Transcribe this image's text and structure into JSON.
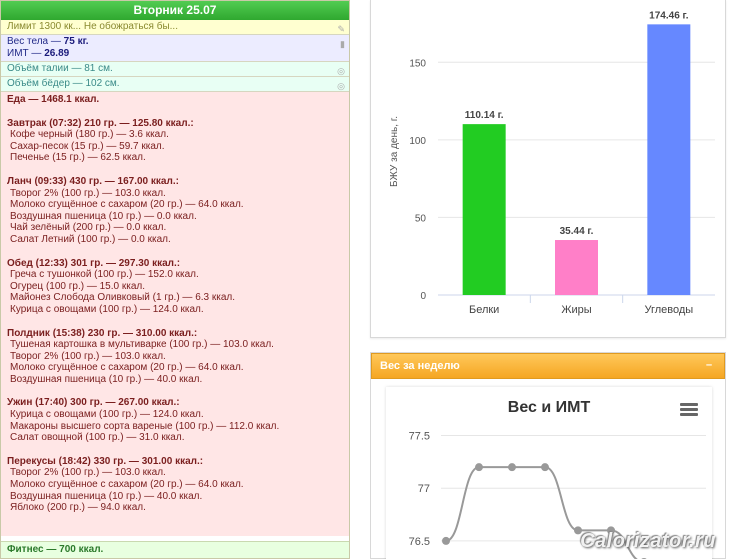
{
  "diary": {
    "date_title": "Вторник 25.07",
    "limit_text": "Лимит 1300 кк... Не обожраться бы...",
    "weight_label": "Вес тела — ",
    "weight_value": "75 кг.",
    "bmi_label": "ИМТ — ",
    "bmi_value": "26.89",
    "waist": "Объём талии — 81 см.",
    "hips": "Объём бёдер — 102 см.",
    "food_total": "Еда — 1468.1 ккал.",
    "meals": [
      {
        "title": "Завтрак (07:32) 210 гр. — 125.80 ккал.:",
        "items": [
          "Кофе черный (180 гр.) — 3.6 ккал.",
          "Сахар-песок (15 гр.) — 59.7 ккал.",
          "Печенье (15 гр.) — 62.5 ккал."
        ]
      },
      {
        "title": "Ланч (09:33) 430 гр. — 167.00 ккал.:",
        "items": [
          "Творог 2% (100 гр.) — 103.0 ккал.",
          "Молоко сгущённое с сахаром (20 гр.) — 64.0 ккал.",
          "Воздушная пшеница (10 гр.) — 0.0 ккал.",
          "Чай зелёный (200 гр.) — 0.0 ккал.",
          "Салат Летний (100 гр.) — 0.0 ккал."
        ]
      },
      {
        "title": "Обед (12:33) 301 гр. — 297.30 ккал.:",
        "items": [
          "Греча с тушонкой (100 гр.) — 152.0 ккал.",
          "Огурец (100 гр.) — 15.0 ккал.",
          "Майонез Слобода Оливковый (1 гр.) — 6.3 ккал.",
          "Курица с овощами (100 гр.) — 124.0 ккал."
        ]
      },
      {
        "title": "Полдник (15:38) 230 гр. — 310.00 ккал.:",
        "items": [
          "Тушеная картошка в мультиварке (100 гр.) — 103.0 ккал.",
          "Творог 2% (100 гр.) — 103.0 ккал.",
          "Молоко сгущённое с сахаром (20 гр.) — 64.0 ккал.",
          "Воздушная пшеница (10 гр.) — 40.0 ккал."
        ]
      },
      {
        "title": "Ужин (17:40) 300 гр. — 267.00 ккал.:",
        "items": [
          "Курица с овощами (100 гр.) — 124.0 ккал.",
          "Макароны высшего сорта вареные (100 гр.) — 112.0 ккал.",
          "Салат овощной (100 гр.) — 31.0 ккал."
        ]
      },
      {
        "title": "Перекусы (18:42) 330 гр. — 301.00 ккал.:",
        "items": [
          "Творог 2% (100 гр.) — 103.0 ккал.",
          "Молоко сгущённое с сахаром (20 гр.) — 64.0 ккал.",
          "Воздушная пшеница (10 гр.) — 40.0 ккал.",
          "Яблоко (200 гр.) — 94.0 ккал."
        ]
      }
    ],
    "fitness": "Фитнес — 700 ккал."
  },
  "weight_panel": {
    "header": "Вес за неделю",
    "collapse_symbol": "–",
    "menu_icon": "hamburger-menu-icon"
  },
  "watermark": "Calorizator.ru",
  "colors": {
    "header_green": "#3cb83c",
    "proteins": "#22cc22",
    "fats": "#ff7fc8",
    "carbs": "#6688ff",
    "panel_orange": "#f7ad3a",
    "line_gray": "#999999"
  },
  "chart_data": [
    {
      "type": "bar",
      "categories": [
        "Белки",
        "Жиры",
        "Углеводы"
      ],
      "values": [
        110.14,
        35.44,
        174.46
      ],
      "data_labels": [
        "110.14 г.",
        "35.44 г.",
        "174.46 г."
      ],
      "colors": [
        "#22cc22",
        "#ff7fc8",
        "#6688ff"
      ],
      "ylabel": "БЖУ за день, г.",
      "ylim": [
        0,
        185
      ],
      "yticks": [
        0,
        50,
        100,
        150
      ],
      "grid": true
    },
    {
      "type": "line",
      "title": "Вес и ИМТ",
      "series": [
        {
          "values": [
            76.5,
            77.2,
            77.2,
            77.2,
            76.6,
            76.6,
            76.3
          ]
        }
      ],
      "ylim": [
        76.3,
        77.6
      ],
      "yticks": [
        76.5,
        77,
        77.5
      ],
      "yticklabels": [
        "76.5",
        "77",
        "77.5"
      ],
      "grid": true
    }
  ]
}
